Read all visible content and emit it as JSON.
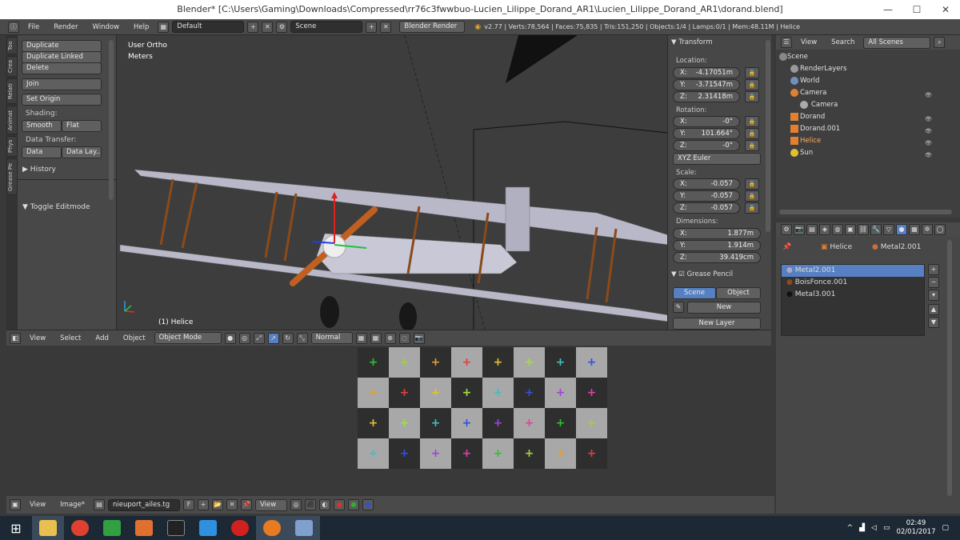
{
  "window": {
    "title": "Blender* [C:\\Users\\Gaming\\Downloads\\Compressed\\rr76c3fwwbuo-Lucien_Lilippe_Dorand_AR1\\Lucien_Lilippe_Dorand_AR1\\dorand.blend]",
    "minimize": "—",
    "maximize": "☐",
    "close": "✕"
  },
  "infobar": {
    "menus": [
      "File",
      "Render",
      "Window",
      "Help"
    ],
    "layout": "Default",
    "scene": "Scene",
    "engine": "Blender Render",
    "stats": "v2.77 | Verts:78,564 | Faces:75,835 | Tris:151,250 | Objects:1/4 | Lamps:0/1 | Mem:48.11M | Helice"
  },
  "tabs": [
    "Too",
    "Crea",
    "Relati",
    "Animat",
    "Phys",
    "Grease Pe"
  ],
  "toolshelf": {
    "duplicate": "Duplicate",
    "duplicate_linked": "Duplicate Linked",
    "delete": "Delete",
    "join": "Join",
    "set_origin": "Set Origin",
    "shading_label": "Shading:",
    "smooth": "Smooth",
    "flat": "Flat",
    "data_transfer_label": "Data Transfer:",
    "data": "Data",
    "data_lay": "Data Lay...",
    "history": "History",
    "toggle_editmode": "Toggle Editmode"
  },
  "viewport": {
    "view_name": "User Ortho",
    "units": "Meters",
    "object_label": "(1) Helice"
  },
  "transform": {
    "header": "Transform",
    "location_label": "Location:",
    "location": [
      {
        "axis": "X:",
        "value": "-4.17051m"
      },
      {
        "axis": "Y:",
        "value": "-3.71547m"
      },
      {
        "axis": "Z:",
        "value": "2.31418m"
      }
    ],
    "rotation_label": "Rotation:",
    "rotation": [
      {
        "axis": "X:",
        "value": "-0°"
      },
      {
        "axis": "Y:",
        "value": "101.664°"
      },
      {
        "axis": "Z:",
        "value": "-0°"
      }
    ],
    "rotation_mode": "XYZ Euler",
    "scale_label": "Scale:",
    "scale": [
      {
        "axis": "X:",
        "value": "-0.057"
      },
      {
        "axis": "Y:",
        "value": "-0.057"
      },
      {
        "axis": "Z:",
        "value": "-0.057"
      }
    ],
    "dimensions_label": "Dimensions:",
    "dimensions": [
      {
        "axis": "X:",
        "value": "1.877m"
      },
      {
        "axis": "Y:",
        "value": "1.914m"
      },
      {
        "axis": "Z:",
        "value": "39.419cm"
      }
    ],
    "grease_pencil": "Grease Pencil",
    "gp_scene": "Scene",
    "gp_object": "Object",
    "gp_new": "New",
    "gp_new_layer": "New Layer"
  },
  "view3d_header": {
    "menus": [
      "View",
      "Select",
      "Add",
      "Object"
    ],
    "mode": "Object Mode",
    "orientation": "Normal"
  },
  "uv_header": {
    "menus": [
      "View",
      "Image*"
    ],
    "image_name": "nieuport_ailes.tg",
    "fake_user": "F",
    "view": "View"
  },
  "outliner": {
    "menus": [
      "View",
      "Search"
    ],
    "filter": "All Scenes",
    "items": [
      {
        "label": "Scene",
        "indent": 0
      },
      {
        "label": "RenderLayers",
        "indent": 1
      },
      {
        "label": "World",
        "indent": 1
      },
      {
        "label": "Camera",
        "indent": 1
      },
      {
        "label": "Camera",
        "indent": 2
      },
      {
        "label": "Dorand",
        "indent": 1
      },
      {
        "label": "Dorand.001",
        "indent": 1
      },
      {
        "label": "Helice",
        "indent": 1
      },
      {
        "label": "Sun",
        "indent": 1
      }
    ]
  },
  "properties": {
    "breadcrumb_object": "Helice",
    "breadcrumb_material": "Metal2.001",
    "materials": [
      "Metal2.001",
      "BoisFonce.001",
      "Metal3.001"
    ]
  },
  "taskbar": {
    "time": "02:49",
    "date": "02/01/2017"
  }
}
